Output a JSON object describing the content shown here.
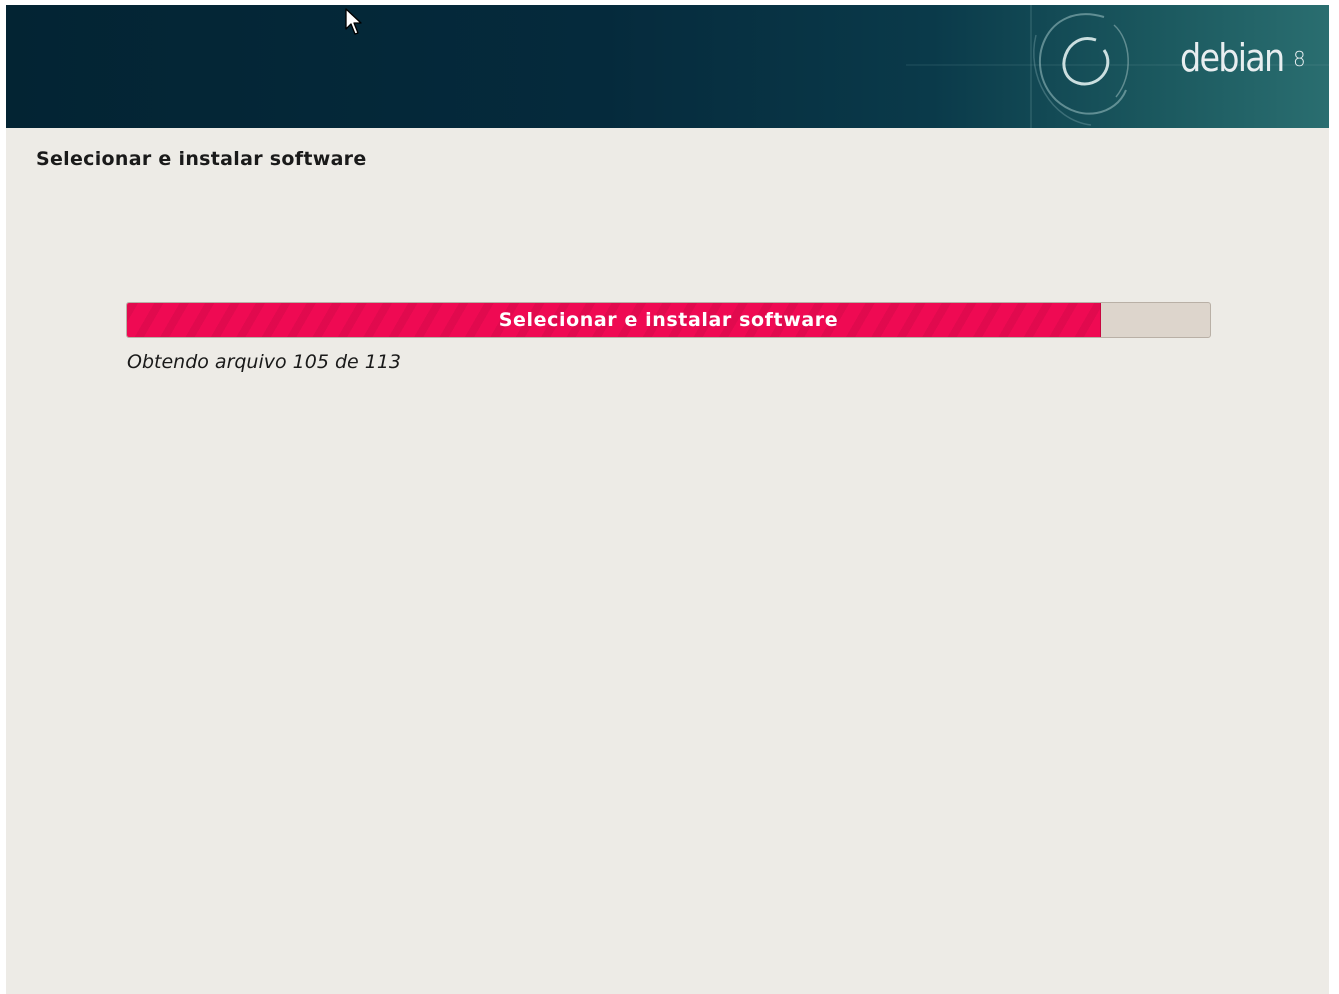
{
  "banner": {
    "logo_text": "debian",
    "logo_version": "8",
    "logo_icon": "debian-swirl-icon"
  },
  "page": {
    "title": "Selecionar e instalar software"
  },
  "progress": {
    "label": "Selecionar e instalar software",
    "status": "Obtendo arquivo 105 de 113",
    "fraction": 0.898,
    "fill_color": "#ef0a53",
    "track_color": "#ddd5cc"
  },
  "cursor": {
    "icon": "mouse-pointer-icon"
  }
}
